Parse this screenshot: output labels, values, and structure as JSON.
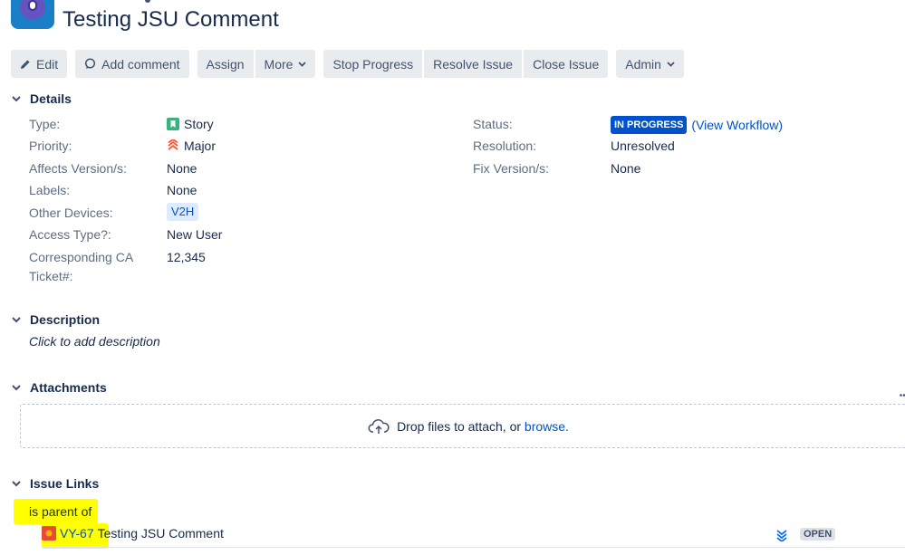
{
  "header": {
    "summary": "Testing JSU Comment"
  },
  "toolbar": {
    "edit": "Edit",
    "add_comment": "Add comment",
    "assign": "Assign",
    "more": "More",
    "stop_progress": "Stop Progress",
    "resolve_issue": "Resolve Issue",
    "close_issue": "Close Issue",
    "admin": "Admin"
  },
  "sections": {
    "details": "Details",
    "description": "Description",
    "attachments": "Attachments",
    "issue_links": "Issue Links"
  },
  "details": {
    "type": {
      "label": "Type:",
      "value": "Story"
    },
    "priority": {
      "label": "Priority:",
      "value": "Major"
    },
    "affects": {
      "label": "Affects Version/s:",
      "value": "None"
    },
    "labels": {
      "label": "Labels:",
      "value": "None"
    },
    "other_devices": {
      "label": "Other Devices:",
      "value": "V2H"
    },
    "access_type": {
      "label": "Access Type?:",
      "value": "New User"
    },
    "ca_ticket": {
      "label_line1": "Corresponding CA",
      "label_line2": "Ticket#:",
      "value": "12,345"
    },
    "status": {
      "label": "Status:",
      "value": "IN PROGRESS",
      "workflow_link": "(View Workflow)"
    },
    "resolution": {
      "label": "Resolution:",
      "value": "Unresolved"
    },
    "fix_version": {
      "label": "Fix Version/s:",
      "value": "None"
    }
  },
  "description": {
    "placeholder": "Click to add description"
  },
  "attachments": {
    "drop_text": "Drop files to attach, or",
    "browse": "browse."
  },
  "issue_links": {
    "relation": "is parent of",
    "linked_key": "VY-67",
    "linked_summary": "Testing JSU Comment",
    "linked_status": "OPEN"
  },
  "colors": {
    "highlight": "#ffff00",
    "link": "#0052cc",
    "in_progress": "#0052cc",
    "story_green": "#36b37e",
    "priority_major": "#ff5630"
  },
  "icons": [
    "edit-icon",
    "comment-icon",
    "chevron-down-icon",
    "story-icon",
    "priority-major-icon",
    "cloud-upload-icon",
    "bug-icon",
    "priority-lowest-icon"
  ]
}
